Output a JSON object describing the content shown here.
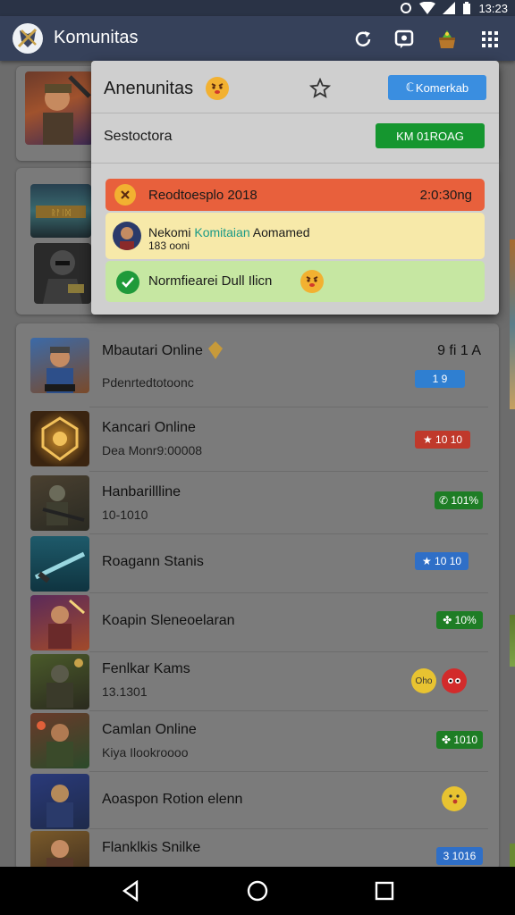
{
  "status": {
    "time": "13:23"
  },
  "appbar": {
    "title": "Komunitas"
  },
  "popup": {
    "title": "Anenunitas",
    "title_emoji": "😡",
    "primary_button": "Komerkab",
    "subtitle": "Sestoctora",
    "secondary_button": "KM 01ROAG",
    "notifications": [
      {
        "title": "Reodtoesplo 2018",
        "time": "2:0:30ng",
        "color": "#e8603c"
      },
      {
        "name": "Nekomi",
        "highlight": "Komitaian",
        "action": "Aomamed",
        "meta": "183 ooni",
        "color": "#f7e9a9"
      },
      {
        "title": "Normfiearei Dull Ilicn",
        "emoji": "😡",
        "color": "#c6e7a2"
      }
    ]
  },
  "list": {
    "items": [
      {
        "title": "Mbautari Online",
        "sub": "Pdenrtedtotoonc",
        "right_text": "9 fi 1 A",
        "badge": "1 9",
        "badge_color": "#2f7fd1"
      },
      {
        "title": "Kancari Online",
        "sub": "Dea Monr9:00008",
        "badge": "★ 10 10",
        "badge_color": "#c0392b"
      },
      {
        "title": "Hanbarillline",
        "sub": "10-1010",
        "badge": "✆ 101%",
        "badge_color": "#1e7d25"
      },
      {
        "title": "Roagann Stanis",
        "sub": "",
        "badge": "★ 10 10",
        "badge_color": "#2f6fc7"
      },
      {
        "title": "Koapin Sleneoelaran",
        "sub": "",
        "badge": "✤ 10%",
        "badge_color": "#1e7d25"
      },
      {
        "title": "Fenlkar Kams",
        "sub": "13.1301",
        "badge": ""
      },
      {
        "title": "Camlan Online",
        "sub": "Kiya Ilookroooo",
        "badge": "✤ 1010",
        "badge_color": "#1e7d25"
      },
      {
        "title": "Aoaspon Rotion elenn",
        "sub": "",
        "badge": ""
      },
      {
        "title": "Flanklkis Snilke",
        "sub": "",
        "badge": "3 1016",
        "badge_color": "#2f6fc7"
      }
    ],
    "reaction_chip": "Oho"
  },
  "icons": {
    "logo": "shield-sword-icon",
    "refresh": "refresh-icon",
    "chat": "chat-bubble-icon",
    "gift": "treasure-icon",
    "grid": "grid-menu-icon",
    "star": "star-outline-icon",
    "nav": [
      "back-icon",
      "home-icon",
      "recents-icon"
    ]
  }
}
